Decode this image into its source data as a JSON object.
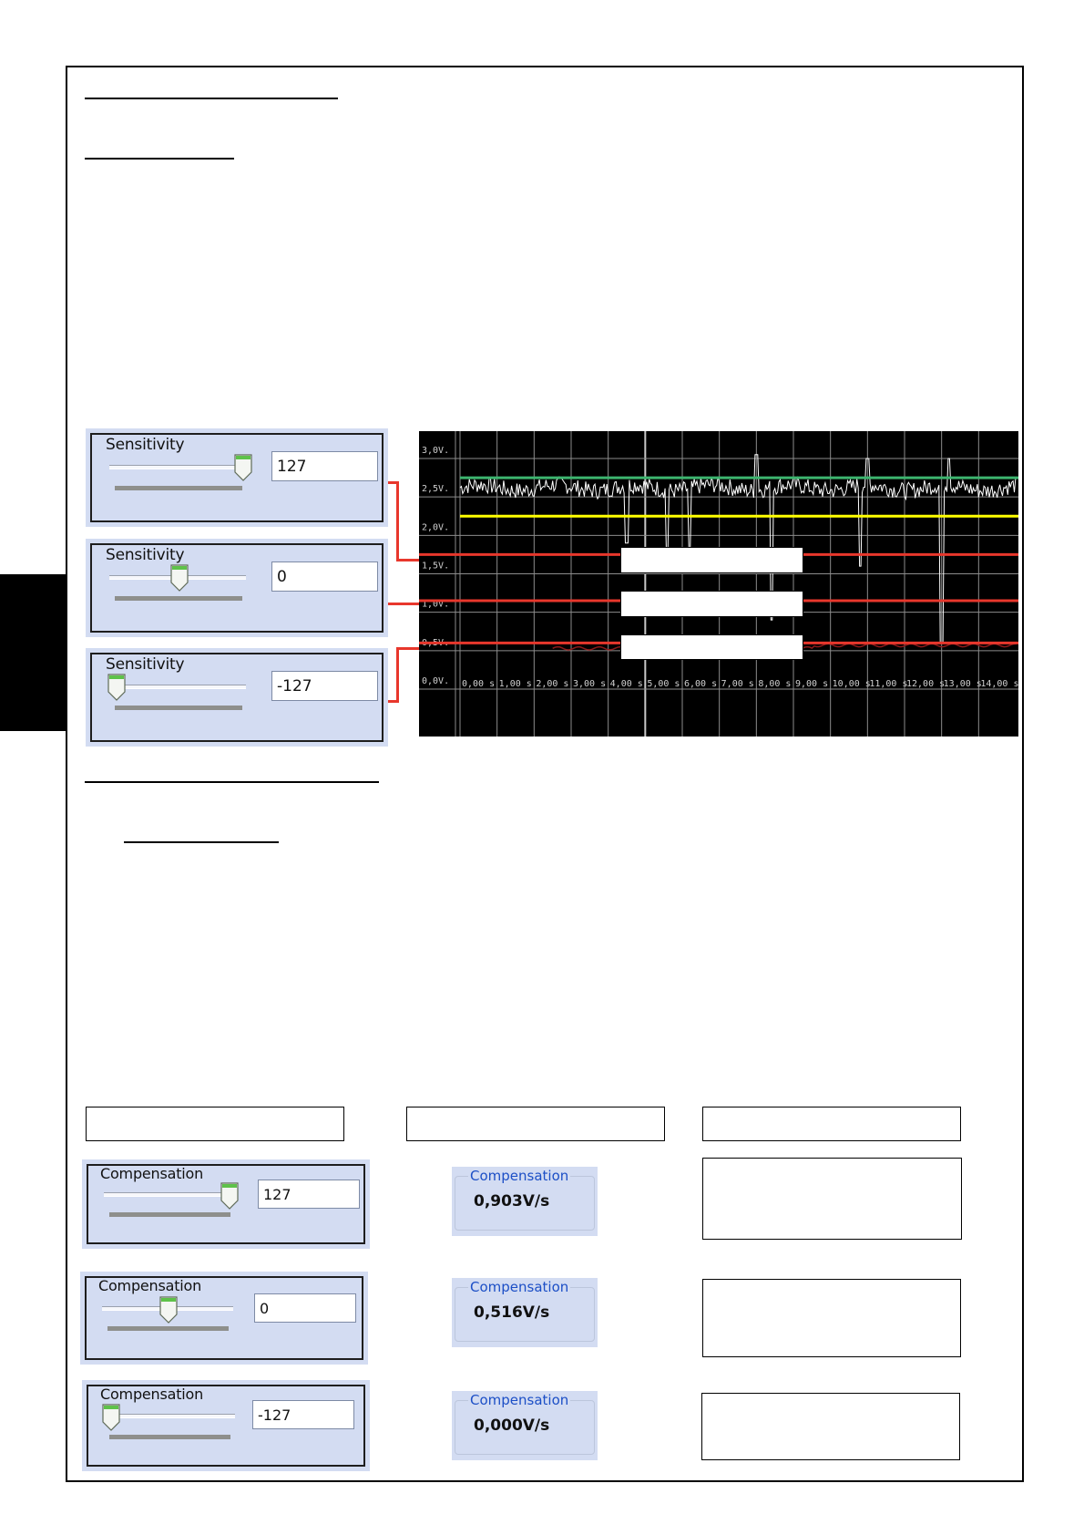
{
  "sensitivity_panels": [
    {
      "label": "Sensitivity",
      "value": "127",
      "level": 1.0
    },
    {
      "label": "Sensitivity",
      "value": "0",
      "level": 0.5
    },
    {
      "label": "Sensitivity",
      "value": "-127",
      "level": 0.0
    }
  ],
  "chart_data": {
    "type": "line",
    "y_tick_labels": [
      "3,0V.",
      "2,5V.",
      "2,0V.",
      "1,5V.",
      "1,0V.",
      "0,5V.",
      "0,0V."
    ],
    "x_tick_labels": [
      "0,00 s",
      "1,00 s",
      "2,00 s",
      "3,00 s",
      "4,00 s",
      "5,00 s",
      "6,00 s",
      "7,00 s",
      "8,00 s",
      "9,00 s",
      "10,00 s",
      "11,00 s",
      "12,00 s",
      "13,00 s",
      "14,00 s"
    ],
    "ylim": [
      0,
      3.0
    ],
    "xlim": [
      0,
      15
    ],
    "grid": true,
    "reference_lines": [
      {
        "y": 2.75,
        "color": "#3cb46e"
      },
      {
        "y": 2.25,
        "color": "#ffff00"
      },
      {
        "y": 1.75,
        "color": "#e8372c"
      },
      {
        "y": 1.15,
        "color": "#e8372c"
      },
      {
        "y": 0.6,
        "color": "#e8372c"
      }
    ],
    "signal_color": "#ffffff",
    "baseline_color": "#8b1a1a"
  },
  "compensation_panels": [
    {
      "label": "Compensation",
      "value": "127",
      "level": 1.0
    },
    {
      "label": "Compensation",
      "value": "0",
      "level": 0.5
    },
    {
      "label": "Compensation",
      "value": "-127",
      "level": 0.0
    }
  ],
  "compensation_readouts": [
    {
      "title": "Compensation",
      "value": "0,903V/s"
    },
    {
      "title": "Compensation",
      "value": "0,516V/s"
    },
    {
      "title": "Compensation",
      "value": "0,000V/s"
    }
  ]
}
